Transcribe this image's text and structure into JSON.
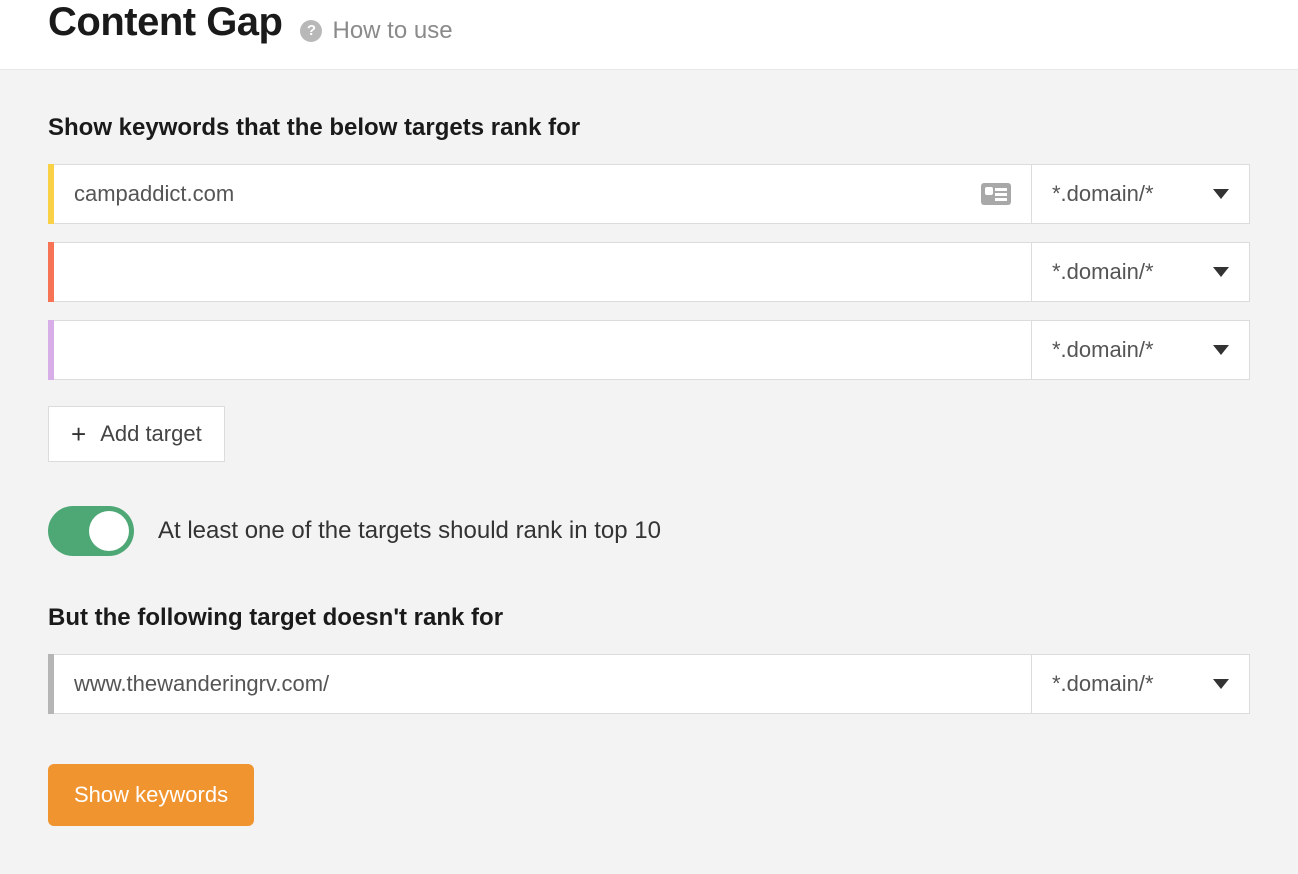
{
  "header": {
    "title": "Content Gap",
    "help_label": "How to use"
  },
  "targets_section": {
    "label": "Show keywords that the below targets rank for",
    "rows": [
      {
        "value": "campaddict.com",
        "mode": "*.domain/*",
        "color": "yellow",
        "has_card_icon": true
      },
      {
        "value": "",
        "mode": "*.domain/*",
        "color": "orange",
        "has_card_icon": false
      },
      {
        "value": "",
        "mode": "*.domain/*",
        "color": "purple",
        "has_card_icon": false
      }
    ],
    "add_target_label": "Add target"
  },
  "toggle": {
    "label": "At least one of the targets should rank in top 10",
    "on": true
  },
  "exclude_section": {
    "label": "But the following target doesn't rank for",
    "row": {
      "value": "www.thewanderingrv.com/",
      "mode": "*.domain/*",
      "color": "gray"
    }
  },
  "submit_label": "Show keywords"
}
